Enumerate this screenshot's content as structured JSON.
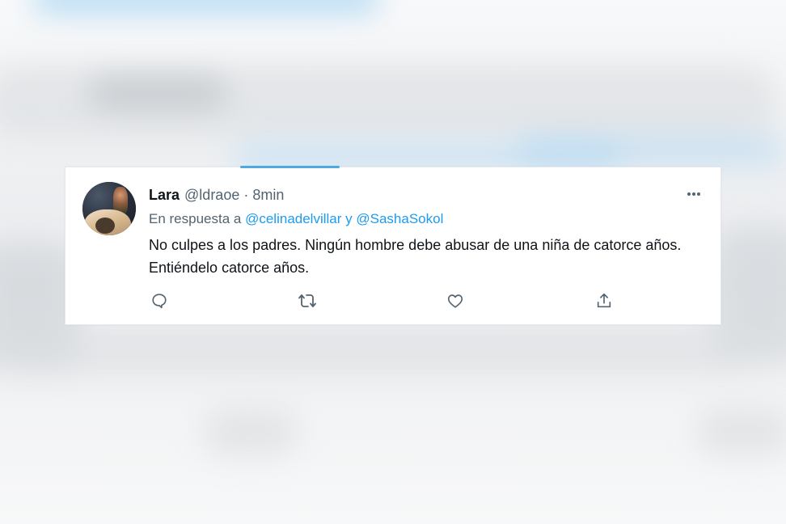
{
  "tweet": {
    "display_name": "Lara",
    "handle": "@ldraoe",
    "separator": "·",
    "time": "8min",
    "reply_prefix": "En respuesta a",
    "reply_mention_1": "@celinadelvillar",
    "reply_conjunction": "y",
    "reply_mention_2": "@SashaSokol",
    "text": "No culpes a los padres. Ningún hombre debe abusar de una niña de catorce años. Entiéndelo catorce años."
  },
  "icons": {
    "more": "more-dots-icon",
    "reply": "reply-bubble-icon",
    "retweet": "retweet-icon",
    "like": "heart-icon",
    "share": "share-icon"
  },
  "colors": {
    "accent": "#1d9bf0",
    "text_primary": "#0f1419",
    "text_secondary": "#536471"
  }
}
